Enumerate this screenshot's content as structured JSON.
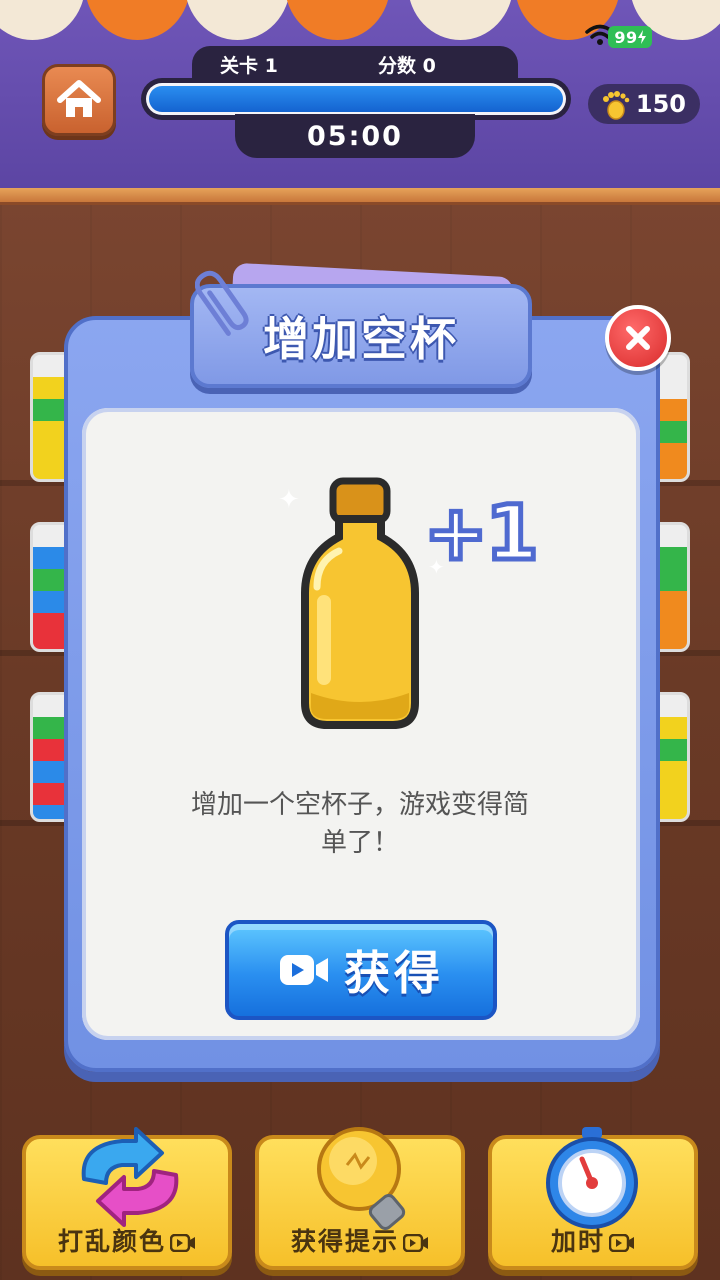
{
  "status": {
    "battery": "99"
  },
  "header": {
    "level_label": "关卡 1",
    "score_label": "分数 0",
    "timer": "05:00",
    "coins": "150",
    "progress": 1.0
  },
  "modal": {
    "title": "增加空杯",
    "bonus": "+1",
    "description": "增加一个空杯子，游戏变得简单了！",
    "get_button": "获得"
  },
  "toolbar": {
    "shuffle_label": "打乱颜色",
    "hint_label": "获得提示",
    "time_label": "加时"
  },
  "colors": {
    "accent_blue": "#2a8ff0",
    "topbar_purple": "#6f56b8",
    "tool_yellow": "#f6c02a",
    "close_red": "#d92b2b"
  }
}
